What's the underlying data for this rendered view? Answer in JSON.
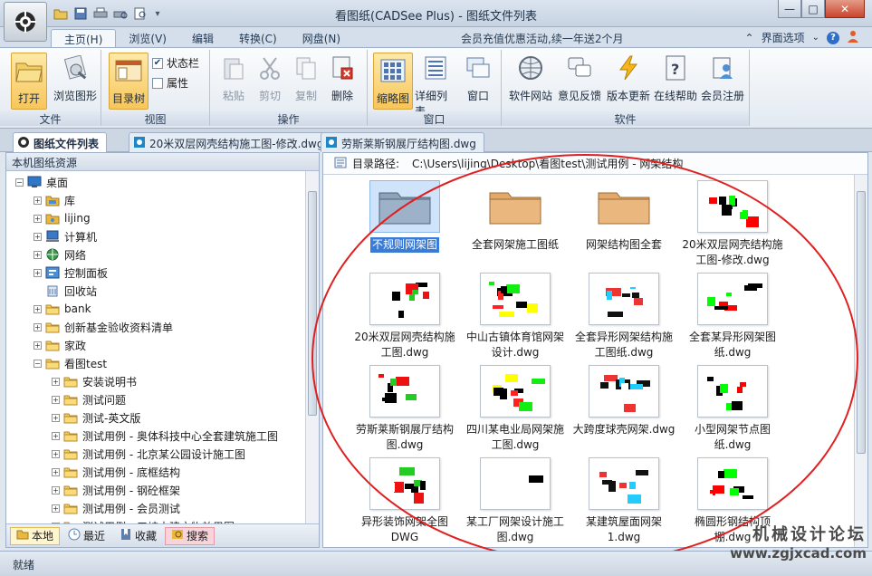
{
  "window": {
    "title": "看图纸(CADSee Plus) - 图纸文件列表",
    "min": "—",
    "max": "□",
    "close": "✕"
  },
  "ribbon_tabs": {
    "home": "主页(H)",
    "browse": "浏览(V)",
    "edit": "编辑",
    "convert": "转换(C)",
    "cloud": "网盘(N)"
  },
  "promo": "会员充值优惠活动,续一年送2个月",
  "interface_options": "界面选项",
  "groups": {
    "file": "文件",
    "view": "视图",
    "operate": "操作",
    "window": "窗口",
    "software": "软件"
  },
  "buttons": {
    "open": "打开",
    "browse_drawing": "浏览图形",
    "dir_tree": "目录树",
    "statusbar": "状态栏",
    "properties": "属性",
    "paste": "粘贴",
    "cut": "剪切",
    "copy": "复制",
    "delete": "删除",
    "thumbnail": "缩略图",
    "detail_list": "详细列表",
    "window": "窗口",
    "website": "软件网站",
    "feedback": "意见反馈",
    "update": "版本更新",
    "online_help": "在线帮助",
    "register": "会员注册"
  },
  "doc_tabs": [
    "图纸文件列表",
    "20米双层网壳结构施工图-修改.dwg",
    "劳斯莱斯钢展厅结构图.dwg"
  ],
  "left_panel": {
    "header": "本机图纸资源",
    "tree": [
      {
        "label": "桌面",
        "level": 0,
        "exp": "−",
        "icon": "desktop-icon"
      },
      {
        "label": "库",
        "level": 1,
        "exp": "+",
        "icon": "library-icon"
      },
      {
        "label": "lijing",
        "level": 1,
        "exp": "+",
        "icon": "user-folder-icon"
      },
      {
        "label": "计算机",
        "level": 1,
        "exp": "+",
        "icon": "computer-icon"
      },
      {
        "label": "网络",
        "level": 1,
        "exp": "+",
        "icon": "network-icon"
      },
      {
        "label": "控制面板",
        "level": 1,
        "exp": "+",
        "icon": "control-panel-icon"
      },
      {
        "label": "回收站",
        "level": 1,
        "exp": "",
        "icon": "recycle-bin-icon"
      },
      {
        "label": "bank",
        "level": 1,
        "exp": "+",
        "icon": "folder-icon"
      },
      {
        "label": "创新基金验收资料清单",
        "level": 1,
        "exp": "+",
        "icon": "folder-icon"
      },
      {
        "label": "家政",
        "level": 1,
        "exp": "+",
        "icon": "folder-icon"
      },
      {
        "label": "看图test",
        "level": 1,
        "exp": "−",
        "icon": "folder-icon"
      },
      {
        "label": "安装说明书",
        "level": 2,
        "exp": "+",
        "icon": "folder-icon"
      },
      {
        "label": "测试问题",
        "level": 2,
        "exp": "+",
        "icon": "folder-icon"
      },
      {
        "label": "测试-英文版",
        "level": 2,
        "exp": "+",
        "icon": "folder-icon"
      },
      {
        "label": "测试用例 - 奥体科技中心全套建筑施工图",
        "level": 2,
        "exp": "+",
        "icon": "folder-icon"
      },
      {
        "label": "测试用例 - 北京某公园设计施工图",
        "level": 2,
        "exp": "+",
        "icon": "folder-icon"
      },
      {
        "label": "测试用例 - 底框结构",
        "level": 2,
        "exp": "+",
        "icon": "folder-icon"
      },
      {
        "label": "测试用例 - 钢砼框架",
        "level": 2,
        "exp": "+",
        "icon": "folder-icon"
      },
      {
        "label": "测试用例 - 会员测试",
        "level": 2,
        "exp": "+",
        "icon": "folder-icon"
      },
      {
        "label": "测试用例 - 三峡古建文物效果图",
        "level": 2,
        "exp": "+",
        "icon": "folder-icon"
      }
    ],
    "footer_tabs": [
      "本地",
      "最近",
      "收藏",
      "搜索"
    ]
  },
  "right_panel": {
    "path_label": "目录路径:",
    "path_value": "C:\\Users\\lijing\\Desktop\\看图test\\测试用例 - 网架结构",
    "items": [
      {
        "name": "不规则网架图",
        "type": "folder"
      },
      {
        "name": "全套网架施工图纸",
        "type": "folder"
      },
      {
        "name": "网架结构图全套",
        "type": "folder"
      },
      {
        "name": "20米双层网壳结构施工图-修改.dwg",
        "type": "dwg"
      },
      {
        "name": "20米双层网壳结构施工图.dwg",
        "type": "dwg"
      },
      {
        "name": "中山古镇体育馆网架设计.dwg",
        "type": "dwg"
      },
      {
        "name": "全套异形网架结构施工图纸.dwg",
        "type": "dwg"
      },
      {
        "name": "全套某异形网架图纸.dwg",
        "type": "dwg"
      },
      {
        "name": "劳斯莱斯钢展厅结构图.dwg",
        "type": "dwg"
      },
      {
        "name": "四川某电业局网架施工图.dwg",
        "type": "dwg"
      },
      {
        "name": "大跨度球壳网架.dwg",
        "type": "dwg"
      },
      {
        "name": "小型网架节点图纸.dwg",
        "type": "dwg"
      },
      {
        "name": "异形装饰网架全图DWG",
        "type": "dwg"
      },
      {
        "name": "某工厂网架设计施工图.dwg",
        "type": "dwg"
      },
      {
        "name": "某建筑屋面网架1.dwg",
        "type": "dwg"
      },
      {
        "name": "椭圆形钢结构顶棚.dwg",
        "type": "dwg"
      }
    ]
  },
  "status": {
    "text": "就绪"
  },
  "watermark": {
    "cn": "机械设计论坛",
    "url": "www.zgjxcad.com"
  },
  "colors": {
    "annotation": "#e02020",
    "accent": "#3a7bd5",
    "ribbon_active": "#f7c65b"
  }
}
